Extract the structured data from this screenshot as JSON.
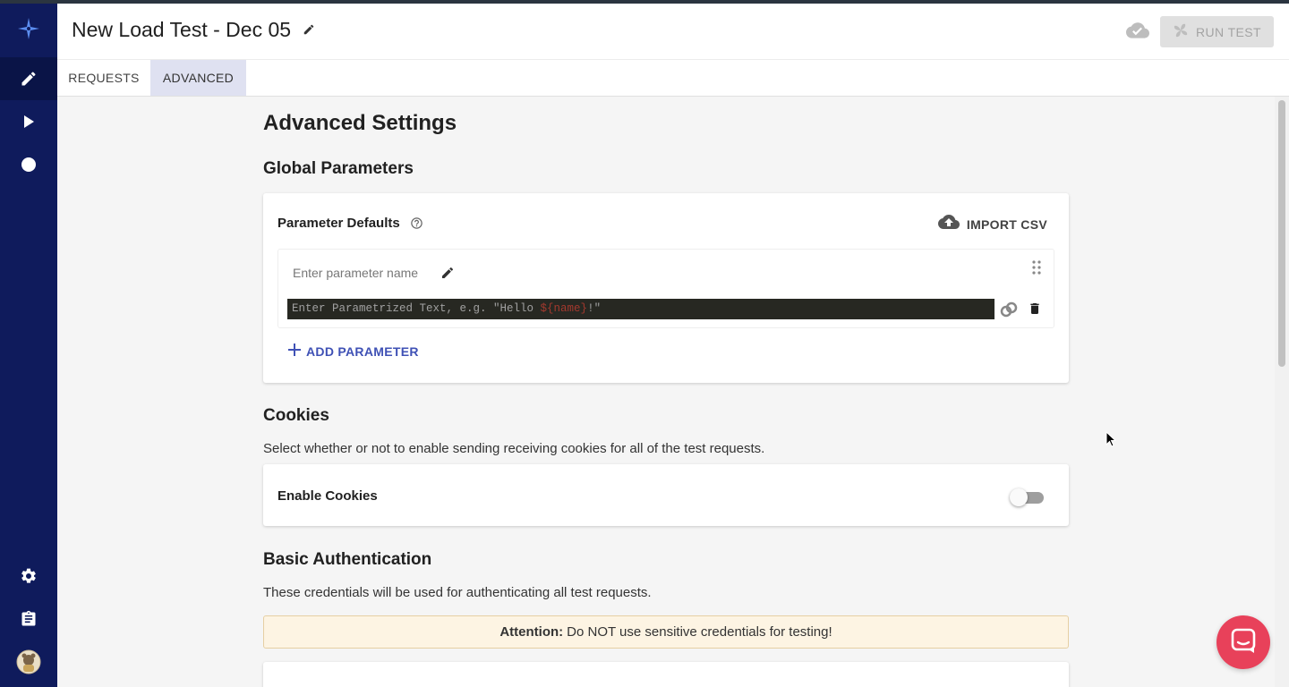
{
  "header": {
    "title": "New Load Test - Dec 05",
    "run_label": "RUN TEST"
  },
  "tabs": [
    {
      "label": "REQUESTS",
      "active": false
    },
    {
      "label": "ADVANCED",
      "active": true
    }
  ],
  "content": {
    "page_title": "Advanced Settings",
    "global_params": {
      "heading": "Global Parameters",
      "card_title": "Parameter Defaults",
      "import_label": "IMPORT CSV",
      "param_name_placeholder": "Enter parameter name",
      "param_text_prefix": "Enter Parametrized Text, e.g. \"Hello ",
      "param_text_var": "${name}",
      "param_text_suffix": "!\"",
      "add_label": "ADD PARAMETER"
    },
    "cookies": {
      "heading": "Cookies",
      "description": "Select whether or not to enable sending receiving cookies for all of the test requests.",
      "toggle_label": "Enable Cookies",
      "enabled": false
    },
    "basic_auth": {
      "heading": "Basic Authentication",
      "description": "These credentials will be used for authenticating all test requests.",
      "attention_label": "Attention:",
      "attention_text": "Do NOT use sensitive credentials for testing!"
    }
  },
  "colors": {
    "sidebar": "#0f1b5c",
    "accent": "#3f51b5",
    "chat": "#e8415a"
  },
  "icons": {
    "sidebar": [
      "logo-icon",
      "edit-icon",
      "play-icon",
      "record-icon",
      "settings-icon",
      "clipboard-icon",
      "avatar"
    ]
  }
}
